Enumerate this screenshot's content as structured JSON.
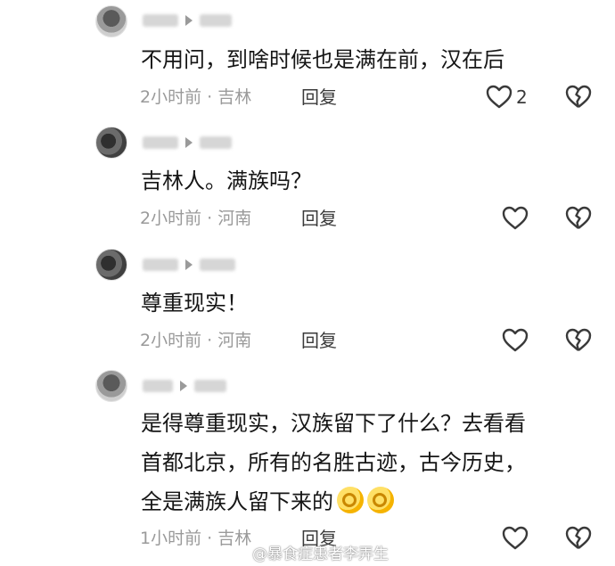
{
  "comments": [
    {
      "text": "不用问，到啥时候也是满在前，汉在后",
      "time": "2小时前",
      "location": "吉林",
      "reply_label": "回复",
      "likes": "2"
    },
    {
      "text": "吉林人。满族吗？",
      "time": "2小时前",
      "location": "河南",
      "reply_label": "回复"
    },
    {
      "text": "尊重现实！",
      "time": "2小时前",
      "location": "河南",
      "reply_label": "回复"
    },
    {
      "text_lines": [
        "是得尊重现实，汉族留下了什么？去看看",
        "首都北京，所有的名胜古迹，古今历史，",
        "全是满族人留下来的"
      ],
      "time": "1小时前",
      "location": "吉林",
      "reply_label": "回复"
    }
  ],
  "separator": " · ",
  "icons": {
    "like": "heart-outline-icon",
    "dislike": "broken-heart-icon",
    "emoji": "ok-hand-emoji"
  },
  "colors": {
    "text": "#161616",
    "meta": "#9a9a9a",
    "icon": "#3a3a3a",
    "background": "#ffffff"
  },
  "watermark": "@暴食症患者李弄生"
}
